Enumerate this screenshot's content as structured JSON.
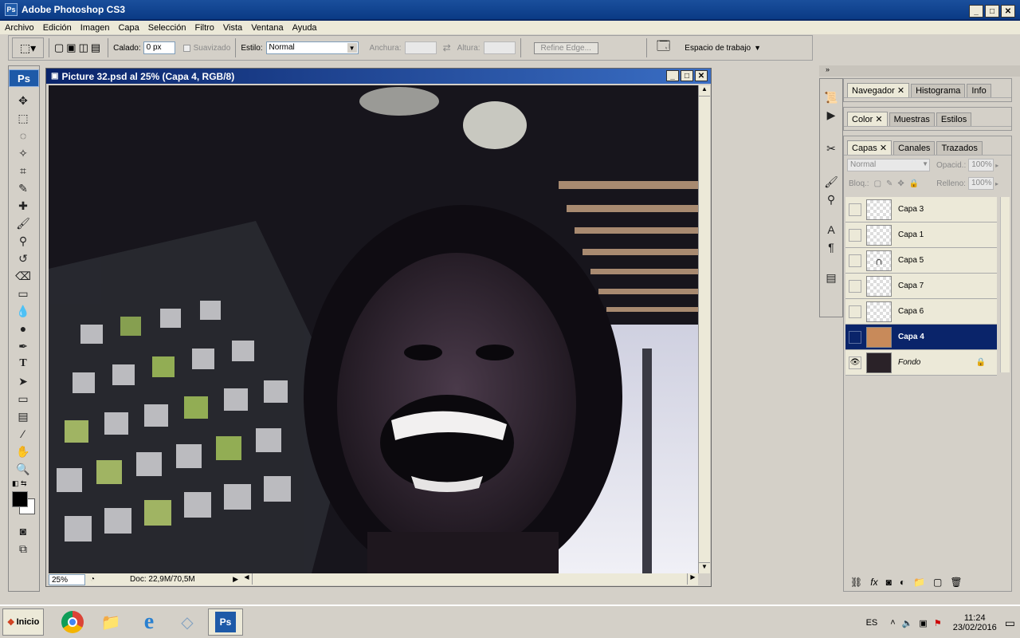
{
  "app": {
    "title": "Adobe Photoshop CS3",
    "logo": "Ps"
  },
  "menu": [
    "Archivo",
    "Edición",
    "Imagen",
    "Capa",
    "Selección",
    "Filtro",
    "Vista",
    "Ventana",
    "Ayuda"
  ],
  "options": {
    "feather_label": "Calado:",
    "feather_value": "0 px",
    "antialias_label": "Suavizado",
    "style_label": "Estilo:",
    "style_value": "Normal",
    "width_label": "Anchura:",
    "height_label": "Altura:",
    "refine_edge": "Refine Edge...",
    "workspace": "Espacio de trabajo"
  },
  "document": {
    "title": "Picture 32.psd al 25% (Capa 4, RGB/8)",
    "zoom": "25%",
    "doc_size": "Doc: 22,9M/70,5M"
  },
  "panels": {
    "top_tabs": [
      "Navegador",
      "Histograma",
      "Info"
    ],
    "color_tabs": [
      "Color",
      "Muestras",
      "Estilos"
    ],
    "layer_tabs": [
      "Capas",
      "Canales",
      "Trazados"
    ],
    "blend_mode": "Normal",
    "opacity_label": "Opacid.:",
    "opacity_value": "100%",
    "lock_label": "Bloq.:",
    "fill_label": "Relleno:",
    "fill_value": "100%"
  },
  "layers": [
    {
      "name": "Capa 3",
      "visible": false,
      "selected": false
    },
    {
      "name": "Capa 1",
      "visible": false,
      "selected": false
    },
    {
      "name": "Capa 5",
      "visible": false,
      "selected": false
    },
    {
      "name": "Capa 7",
      "visible": false,
      "selected": false
    },
    {
      "name": "Capa 6",
      "visible": false,
      "selected": false
    },
    {
      "name": "Capa 4",
      "visible": false,
      "selected": true
    },
    {
      "name": "Fondo",
      "visible": true,
      "selected": false,
      "locked": true
    }
  ],
  "taskbar": {
    "start": "Inicio",
    "lang": "ES",
    "time": "11:24",
    "date": "23/02/2016"
  },
  "colors": {
    "title_bar": "#0a3a85",
    "selected_layer": "#0a246a",
    "foreground": "#000000",
    "background": "#ffffff"
  }
}
